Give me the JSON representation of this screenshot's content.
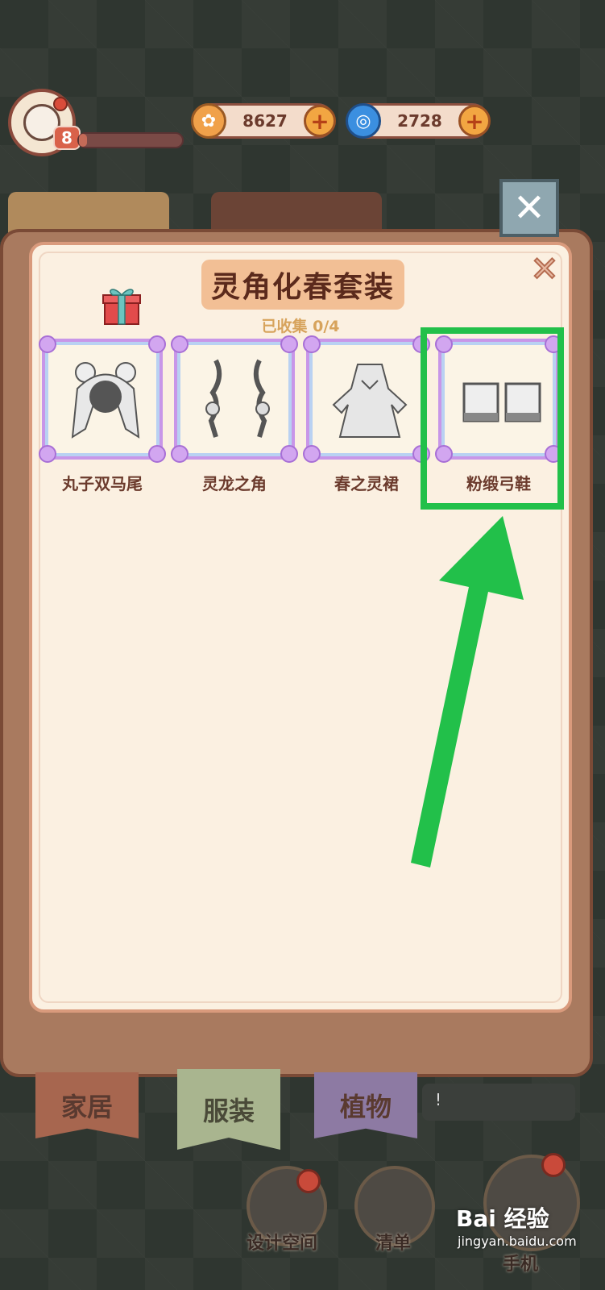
{
  "header": {
    "level": "8",
    "xp_progress": 0.08,
    "currency_coins": {
      "amount": "8627",
      "icon": "coin-icon",
      "color": "#f0a14a"
    },
    "currency_gems": {
      "amount": "2728",
      "icon": "swirl-gem-icon",
      "color": "#3b8fe0"
    }
  },
  "panel": {
    "title": "灵角化春套装",
    "progress": "已收集 0/4",
    "items": [
      {
        "label": "丸子双马尾",
        "icon": "hairstyle-icon"
      },
      {
        "label": "灵龙之角",
        "icon": "dragon-horn-icon"
      },
      {
        "label": "春之灵裙",
        "icon": "dress-icon"
      },
      {
        "label": "粉缎弓鞋",
        "icon": "shoes-icon"
      }
    ]
  },
  "tabs": {
    "home": "家居",
    "clothes": "服装",
    "plants": "植物"
  },
  "speech": "!",
  "nav": {
    "design": "设计空间",
    "list": "清单",
    "phone": "手机"
  },
  "watermark": {
    "brand": "Bai 经验",
    "url": "jingyan.baidu.com"
  },
  "colors": {
    "highlight": "#22c04a",
    "panel_bg": "#fbf0e1",
    "frame_purple": "#c896e8"
  }
}
